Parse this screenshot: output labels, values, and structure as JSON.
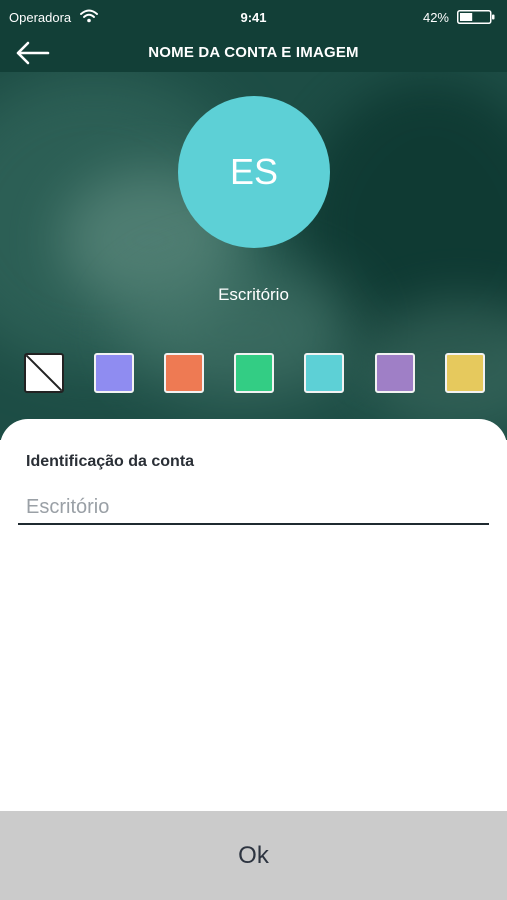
{
  "status_bar": {
    "carrier": "Operadora",
    "time": "9:41",
    "battery_percent": "42%",
    "battery_level": 0.42
  },
  "nav": {
    "back_icon": "arrow-left-icon",
    "title": "NOME DA CONTA E IMAGEM"
  },
  "avatar": {
    "initials": "ES",
    "color": "#5dd0d6"
  },
  "account_name": "Escritório",
  "swatches": [
    {
      "name": "none",
      "color": "#ffffff",
      "selected": true
    },
    {
      "name": "periwinkle",
      "color": "#8f8cf1"
    },
    {
      "name": "orange",
      "color": "#ee7a53"
    },
    {
      "name": "green",
      "color": "#33cd84"
    },
    {
      "name": "cyan",
      "color": "#5dd0d6"
    },
    {
      "name": "purple",
      "color": "#9f7fc6"
    },
    {
      "name": "yellow",
      "color": "#e6c95d"
    }
  ],
  "form": {
    "label": "Identificação da conta",
    "input_placeholder": "Escritório",
    "input_value": ""
  },
  "ok_button": {
    "label": "Ok"
  },
  "colors": {
    "header_bg": "#123f37",
    "sheet_bg": "#ffffff",
    "ok_bg": "#cbcbcb"
  }
}
